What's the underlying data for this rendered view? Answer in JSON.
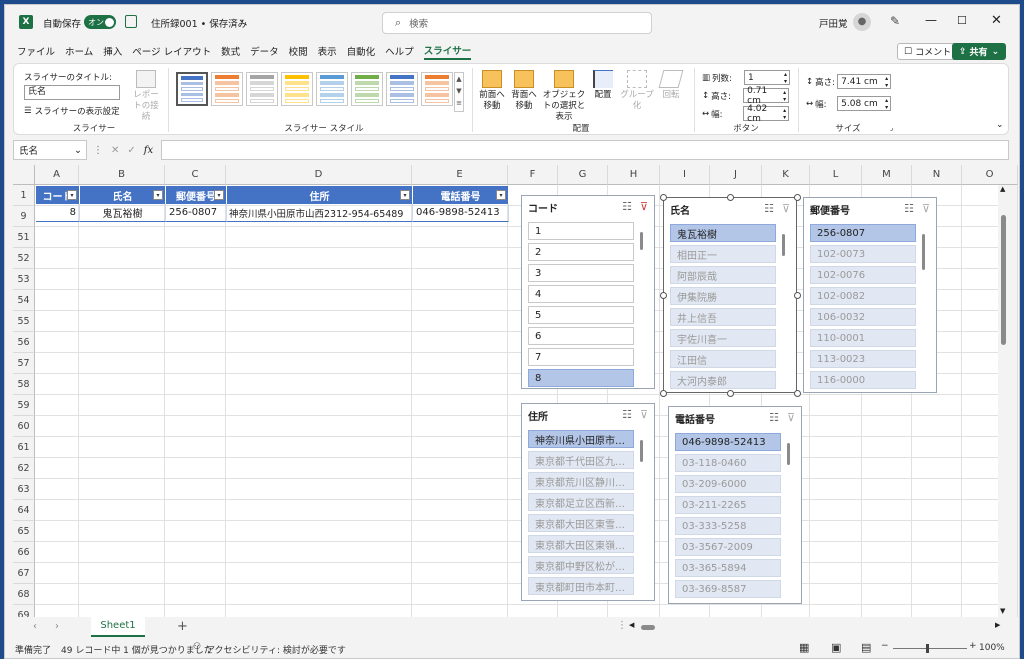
{
  "titlebar": {
    "autosave_label": "自動保存",
    "autosave_state": "オン",
    "doc_title": "住所録001 • 保存済み",
    "search_placeholder": "検索",
    "user_name": "戸田覚"
  },
  "menu": [
    "ファイル",
    "ホーム",
    "挿入",
    "ページ レイアウト",
    "数式",
    "データ",
    "校閲",
    "表示",
    "自動化",
    "ヘルプ",
    "スライサー"
  ],
  "menu_active_index": 10,
  "comment_label": "コメント",
  "share_label": "共有",
  "ribbon": {
    "slicer_title_label": "スライサーのタイトル:",
    "slicer_title_value": "氏名",
    "slicer_settings_label": "スライサーの表示設定",
    "report_conn_label": "レポートの接続",
    "group_slicer": "スライサー",
    "group_style": "スライサー スタイル",
    "bring_forward": "前面へ移動",
    "send_backward": "背面へ移動",
    "selection_pane": "オブジェクトの選択と表示",
    "align": "配置",
    "group": "グループ化",
    "rotate": "回転",
    "group_arrange": "配置",
    "columns_label": "列数:",
    "columns_value": "1",
    "btn_height_label": "高さ:",
    "btn_height_value": "0.71 cm",
    "btn_width_label": "幅:",
    "btn_width_value": "4.02 cm",
    "group_buttons": "ボタン",
    "size_height_label": "高さ:",
    "size_height_value": "7.41 cm",
    "size_width_label": "幅:",
    "size_width_value": "5.08 cm",
    "group_size": "サイズ"
  },
  "style_colors": [
    "#4472c4",
    "#ed7d31",
    "#a5a5a5",
    "#ffc000",
    "#5b9bd5",
    "#70ad47",
    "#4472c4",
    "#ed7d31"
  ],
  "formula_bar": {
    "name_box": "氏名",
    "formula": ""
  },
  "grid": {
    "columns": [
      "A",
      "B",
      "C",
      "D",
      "E",
      "F",
      "G",
      "H",
      "I",
      "J",
      "K",
      "L",
      "M",
      "N",
      "O"
    ],
    "rows": [
      "1",
      "9",
      "51",
      "52",
      "53",
      "54",
      "55",
      "56",
      "57",
      "58",
      "59",
      "60",
      "61",
      "62",
      "63",
      "64",
      "65",
      "66",
      "67",
      "68",
      "69",
      "70",
      "71",
      "72"
    ],
    "table_headers": [
      "コード",
      "氏名",
      "郵便番号",
      "住所",
      "電話番号"
    ],
    "table_row": [
      "8",
      "鬼瓦裕樹",
      "256-0807",
      "神奈川県小田原市山西2312-954-65489",
      "046-9898-52413"
    ]
  },
  "slicers": {
    "code": {
      "title": "コード",
      "items": [
        "1",
        "2",
        "3",
        "4",
        "5",
        "6",
        "7",
        "8"
      ],
      "selected": [
        7
      ]
    },
    "name": {
      "title": "氏名",
      "items": [
        "鬼瓦裕樹",
        "相田正一",
        "阿部辰哉",
        "伊集院勝",
        "井上信吾",
        "宇佐川喜一",
        "江田信",
        "大河内泰郎"
      ],
      "selected": [
        0
      ]
    },
    "zip": {
      "title": "郵便番号",
      "items": [
        "256-0807",
        "102-0073",
        "102-0076",
        "102-0082",
        "106-0032",
        "110-0001",
        "113-0023",
        "116-0000"
      ],
      "selected": [
        0
      ]
    },
    "address": {
      "title": "住所",
      "items": [
        "神奈川県小田原市…",
        "東京都千代田区九…",
        "東京都荒川区静川…",
        "東京都足立区西新…",
        "東京都大田区東雪…",
        "東京都大田区東嶺…",
        "東京都中野区松が…",
        "東京都町田市本町…"
      ],
      "selected": [
        0
      ]
    },
    "phone": {
      "title": "電話番号",
      "items": [
        "046-9898-52413",
        "03-118-0460",
        "03-209-6000",
        "03-211-2265",
        "03-333-5258",
        "03-3567-2009",
        "03-365-5894",
        "03-369-8587"
      ],
      "selected": [
        0
      ]
    }
  },
  "sheet_tab": "Sheet1",
  "status": {
    "ready": "準備完了",
    "records": "49 レコード中 1 個が見つかりました",
    "accessibility": "アクセシビリティ: 検討が必要です",
    "zoom": "100%"
  }
}
